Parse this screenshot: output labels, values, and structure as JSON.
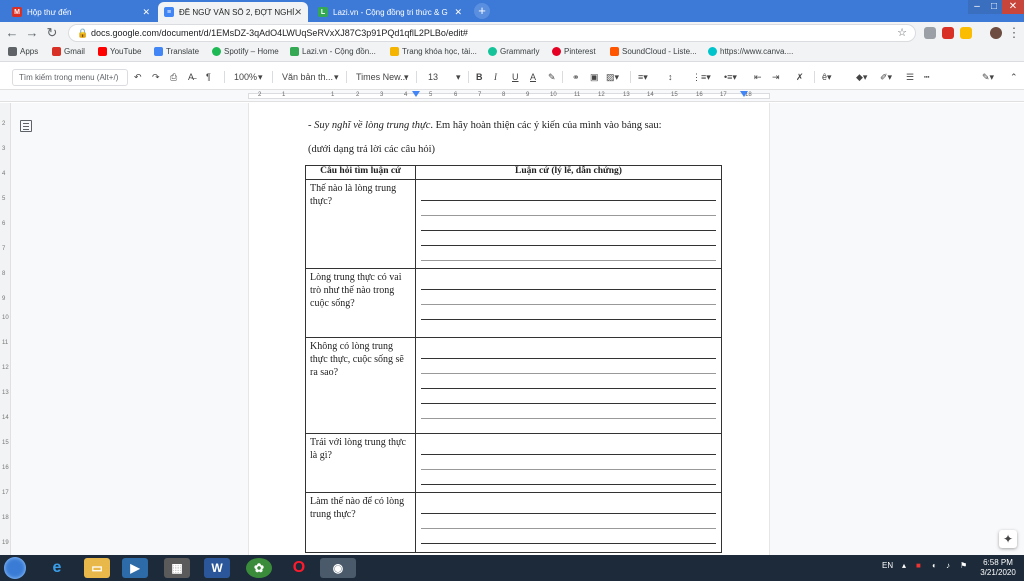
{
  "browser": {
    "tabs": [
      {
        "title": "Hộp thư đến",
        "favicon_color": "#d93025",
        "favicon_glyph": "M"
      },
      {
        "title": "ĐỀ NGỮ VĂN SỐ 2, ĐỢT NGHỈ...",
        "favicon_color": "#4285f4",
        "favicon_glyph": "≡"
      },
      {
        "title": "Lazi.vn - Cộng đồng tri thức & G",
        "favicon_color": "#34a853",
        "favicon_glyph": "L"
      }
    ],
    "newtab_glyph": "+",
    "address": "docs.google.com/document/d/1EMsDZ-3qAdO4LWUqSeRVxXJ87C3p91PQd1qflL2PLBo/edit#",
    "bookmarks": [
      {
        "label": "Apps",
        "color": "#5f6368"
      },
      {
        "label": "Gmail",
        "color": "#d93025"
      },
      {
        "label": "YouTube",
        "color": "#ff0000"
      },
      {
        "label": "Translate",
        "color": "#4285f4"
      },
      {
        "label": "Spotify – Home",
        "color": "#1db954"
      },
      {
        "label": "Lazi.vn - Cộng đồn...",
        "color": "#34a853"
      },
      {
        "label": "Trang khóa học, tài...",
        "color": "#f4b400"
      },
      {
        "label": "Grammarly",
        "color": "#15c39a"
      },
      {
        "label": "Pinterest",
        "color": "#e60023"
      },
      {
        "label": "SoundCloud - Liste...",
        "color": "#ff5500"
      },
      {
        "label": "https://www.canva....",
        "color": "#00c4cc"
      }
    ]
  },
  "toolbar": {
    "menu_search_placeholder": "Tìm kiếm trong menu (Alt+/)",
    "zoom": "100%",
    "style": "Văn bản th...",
    "font": "Times New...",
    "size": "13",
    "bold": "B",
    "italic": "I",
    "underline": "U",
    "textcolor": "A"
  },
  "ruler": {
    "numbers": [
      "2",
      "1",
      "1",
      "2",
      "3",
      "4",
      "5",
      "6",
      "7",
      "8",
      "9",
      "10",
      "11",
      "12",
      "13",
      "14",
      "15",
      "16",
      "17",
      "18"
    ]
  },
  "vruler": {
    "numbers": [
      "2",
      "3",
      "4",
      "5",
      "6",
      "7",
      "8",
      "9",
      "10",
      "11",
      "12",
      "13",
      "14",
      "15",
      "16",
      "17",
      "18",
      "19"
    ]
  },
  "document": {
    "line1_prefix": "- ",
    "line1_italic": "Suy nghĩ về lòng trung thực",
    "line1_rest": ". Em hãy hoàn thiện các ý kiến của mình vào bảng sau:",
    "line2": "(dưới dạng trả lời các câu hỏi)",
    "table": {
      "headers": [
        "Câu hỏi tìm luận cứ",
        "Luận cứ (lý lẽ, dẫn chứng)"
      ],
      "rows": [
        {
          "question": "Thế nào là lòng trung thực?",
          "lines": 6
        },
        {
          "question": "Lòng trung thực có vai trò như thế nào trong cuộc sống?",
          "lines": 4
        },
        {
          "question": "Không có lòng trung thực thực, cuộc sống sẽ ra sao?",
          "lines": 6
        },
        {
          "question": "Trái với lòng trung thực là gì?",
          "lines": 4
        },
        {
          "question": "Làm thế nào để có lòng trung thực?",
          "lines": 3
        }
      ]
    }
  },
  "taskbar": {
    "language": "EN",
    "time": "6:58 PM",
    "date": "3/21/2020"
  }
}
